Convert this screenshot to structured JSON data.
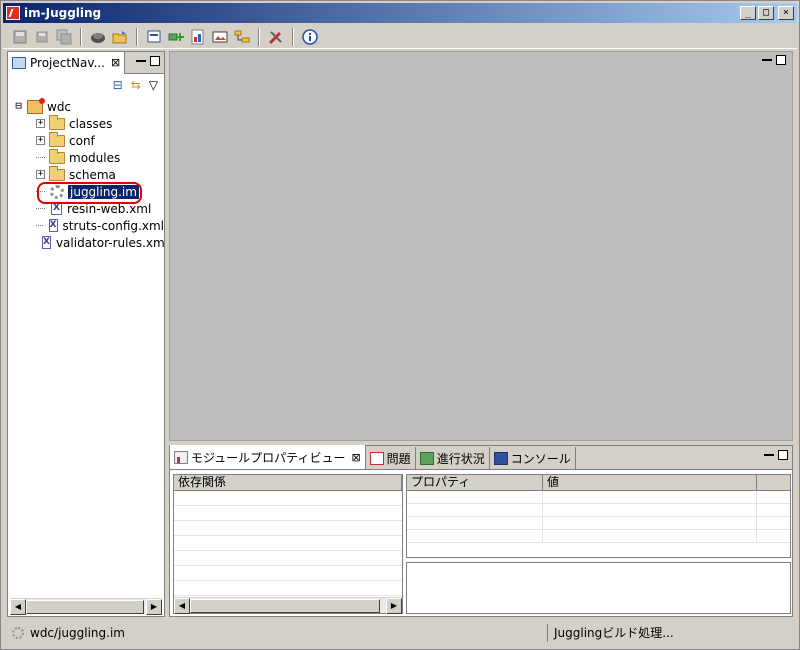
{
  "window": {
    "title": "im-Juggling",
    "minimize_label": "_",
    "maximize_label": "□",
    "close_label": "×"
  },
  "toolbar": {
    "icons": [
      "save-icon",
      "save-as-icon",
      "save-all-icon",
      "server-icon",
      "open-folder-icon",
      "module-icon",
      "add-module-icon",
      "properties-icon",
      "image-icon",
      "hierarchy-icon",
      "tools-icon",
      "info-icon"
    ]
  },
  "navigator": {
    "tab_label": "ProjectNav...",
    "tab_close": "⊠",
    "collapse_label": "⊟",
    "sync_label": "⇆",
    "menu_label": "▽",
    "tree": {
      "root": {
        "label": "wdc",
        "expander": "⊟"
      },
      "items": [
        {
          "label": "classes",
          "type": "folder",
          "expander": "+"
        },
        {
          "label": "conf",
          "type": "folder",
          "expander": "+"
        },
        {
          "label": "modules",
          "type": "folder",
          "expander": ""
        },
        {
          "label": "schema",
          "type": "folder",
          "expander": "+"
        },
        {
          "label": "juggling.im",
          "type": "juggling-file",
          "selected": true
        },
        {
          "label": "resin-web.xml",
          "type": "xml",
          "icon_letter": "X"
        },
        {
          "label": "struts-config.xml",
          "type": "xml",
          "icon_letter": "X"
        },
        {
          "label": "validator-rules.xml",
          "type": "xml",
          "icon_letter": "X"
        }
      ]
    },
    "scroll_left": "◀",
    "scroll_right": "▶"
  },
  "bottom_views": {
    "tabs": [
      {
        "label": "モジュールプロパティビュー",
        "close": "⊠",
        "active": true
      },
      {
        "label": "問題"
      },
      {
        "label": "進行状況"
      },
      {
        "label": "コンソール"
      }
    ],
    "dependency_table": {
      "header": "依存関係"
    },
    "property_table": {
      "headers": [
        "プロパティ",
        "値"
      ]
    }
  },
  "statusbar": {
    "path": "wdc/juggling.im",
    "job": "Jugglingビルド処理..."
  },
  "colors": {
    "selection": "#0a246a",
    "highlight_ring": "#e00000"
  }
}
